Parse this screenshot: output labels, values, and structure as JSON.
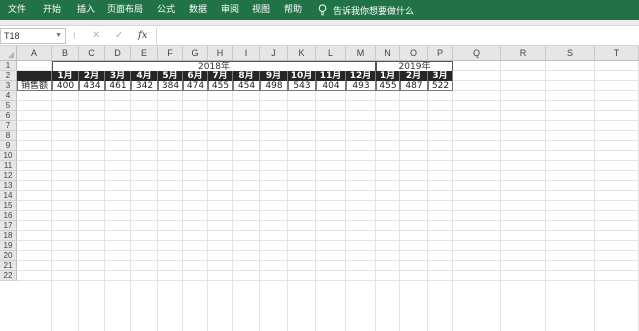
{
  "ribbon": {
    "tabs": [
      "文件",
      "开始",
      "插入",
      "页面布局",
      "公式",
      "数据",
      "审阅",
      "视图",
      "帮助"
    ],
    "tell_me": "告诉我你想要做什么"
  },
  "formula_bar": {
    "name_box": "T18",
    "cancel_symbol": "✕",
    "enter_symbol": "✓",
    "fx_symbol": "fx",
    "formula": ""
  },
  "columns": [
    "A",
    "B",
    "C",
    "D",
    "E",
    "F",
    "G",
    "H",
    "I",
    "J",
    "K",
    "L",
    "M",
    "N",
    "O",
    "P",
    "Q",
    "R",
    "S",
    "T"
  ],
  "rows": [
    "1",
    "2",
    "3",
    "4",
    "5",
    "6",
    "7",
    "8",
    "9",
    "10",
    "11",
    "12",
    "13",
    "14",
    "15",
    "16",
    "17",
    "18",
    "19",
    "20",
    "21",
    "22"
  ],
  "sheet": {
    "years": [
      "2018年",
      "2019年"
    ],
    "months": [
      "1月",
      "2月",
      "3月",
      "4月",
      "5月",
      "6月",
      "7月",
      "8月",
      "9月",
      "10月",
      "11月",
      "12月",
      "1月",
      "2月",
      "3月"
    ],
    "row_label": "销售额",
    "values": [
      "400",
      "434",
      "461",
      "342",
      "384",
      "474",
      "455",
      "454",
      "498",
      "543",
      "404",
      "493",
      "455",
      "487",
      "522"
    ]
  },
  "colors": {
    "ribbon_bg": "#217346",
    "header_row_bg": "#262626",
    "header_row_text": "#ffffff"
  }
}
